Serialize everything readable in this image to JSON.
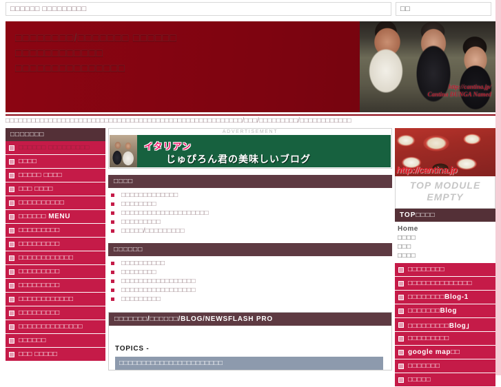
{
  "topbar": {
    "main_field_text": "□□□□□□ □□□□□□□□□",
    "side_field_text": "□□"
  },
  "hero": {
    "lines": [
      "□□□□□□□□/□□□□□□□ □□□□□□",
      "□□□□□□□□□□□□",
      "□□□□□□□□□□□□□□□"
    ],
    "photo_watermark_line1": "http://cantina.jp/",
    "photo_watermark_line2": "Cantina DUNGA Named",
    "photo_name": "three-chefs-photo"
  },
  "pathway": "□□□□□□□□□□□□□□□□□□□□□□□□□□□□□□□□□□□□□□□□□□□□□□□□□□□□□□□/□□□/□□□□□□□□□/□□□□□□□□□□□□",
  "left_sidebar": {
    "title": "□□□□□□□",
    "items": [
      {
        "label": "□□□□□□ □□□□□□□□□",
        "active": true
      },
      {
        "label": "□□□□",
        "active": false
      },
      {
        "label": "□□□□□ □□□□",
        "active": false
      },
      {
        "label": "□□□ □□□□",
        "active": false
      },
      {
        "label": "□□□□□□□□□□",
        "active": false
      },
      {
        "label": "□□□□□□ MENU",
        "active": false
      },
      {
        "label": "□□□□□□□□□",
        "active": false
      },
      {
        "label": "□□□□□□□□□",
        "active": false
      },
      {
        "label": "□□□□□□□□□□□□",
        "active": false
      },
      {
        "label": "□□□□□□□□□",
        "active": false
      },
      {
        "label": "□□□□□□□□□",
        "active": false
      },
      {
        "label": "□□□□□□□□□□□□",
        "active": false
      },
      {
        "label": "□□□□□□□□□",
        "active": false
      },
      {
        "label": "□□□□□□□□□□□□□□",
        "active": false
      },
      {
        "label": "□□□□□□",
        "active": false
      },
      {
        "label": "□□□ □□□□□",
        "active": false
      }
    ]
  },
  "middle": {
    "ad": {
      "label": "ADVERTISEMENT",
      "banner_pink_text": "イタリアン",
      "banner_white_text": "じゅぴろん君の美味しいブログ",
      "banner_bg": "#17613f",
      "banner_pink": "#ec1b6b"
    },
    "section_1": {
      "heading": "□□□□",
      "links": [
        "□□□□□□□□□□□□□",
        "□□□□□□□□",
        "□□□□□□□□□□□□□□□□□□□□",
        "□□□□□□□□□",
        "□□□□□/□□□□□□□□□"
      ]
    },
    "section_2": {
      "heading": "□□□□□□",
      "links": [
        "□□□□□□□□□□",
        "□□□□□□□□",
        "□□□□□□□□□□□□□□□□□",
        "□□□□□□□□□□□□□□□□□",
        "□□□□□□□□□"
      ]
    },
    "blog_panel": {
      "heading": "□□□□□□□/□□□□□□/BLOG/NEWSFLASH PRO",
      "topics_label": "TOPICS -",
      "topic_bar": "□□□□□□□□□□□□□□□□□□□□□□□",
      "topic_bar_color": "#8d9aad"
    }
  },
  "right_sidebar": {
    "photo_watermark": "http://cantina.jp",
    "photo_name": "pizza-pasta-photo",
    "empty_module_line1": "TOP MODULE",
    "empty_module_line2": "EMPTY",
    "title": "TOP□□□□",
    "plain_links": [
      "Home",
      "□□□□",
      "□□□",
      "□□□□"
    ],
    "items": [
      {
        "label": "□□□□□□□□"
      },
      {
        "label": "□□□□□□□□□□□□□□"
      },
      {
        "label": "□□□□□□□□Blog-1"
      },
      {
        "label": "□□□□□□□Blog"
      },
      {
        "label": "□□□□□□□□□Blog」"
      },
      {
        "label": "□□□□□□□□□"
      },
      {
        "label": "google map□□"
      },
      {
        "label": "□□□□□□□"
      },
      {
        "label": "□□□□□"
      }
    ]
  },
  "colors": {
    "hero_red": "#8c0512",
    "crimson": "#c51b48",
    "dark_maroon": "#543037",
    "section_head": "#5e3a42",
    "edge_pink": "#f6cdd6"
  }
}
